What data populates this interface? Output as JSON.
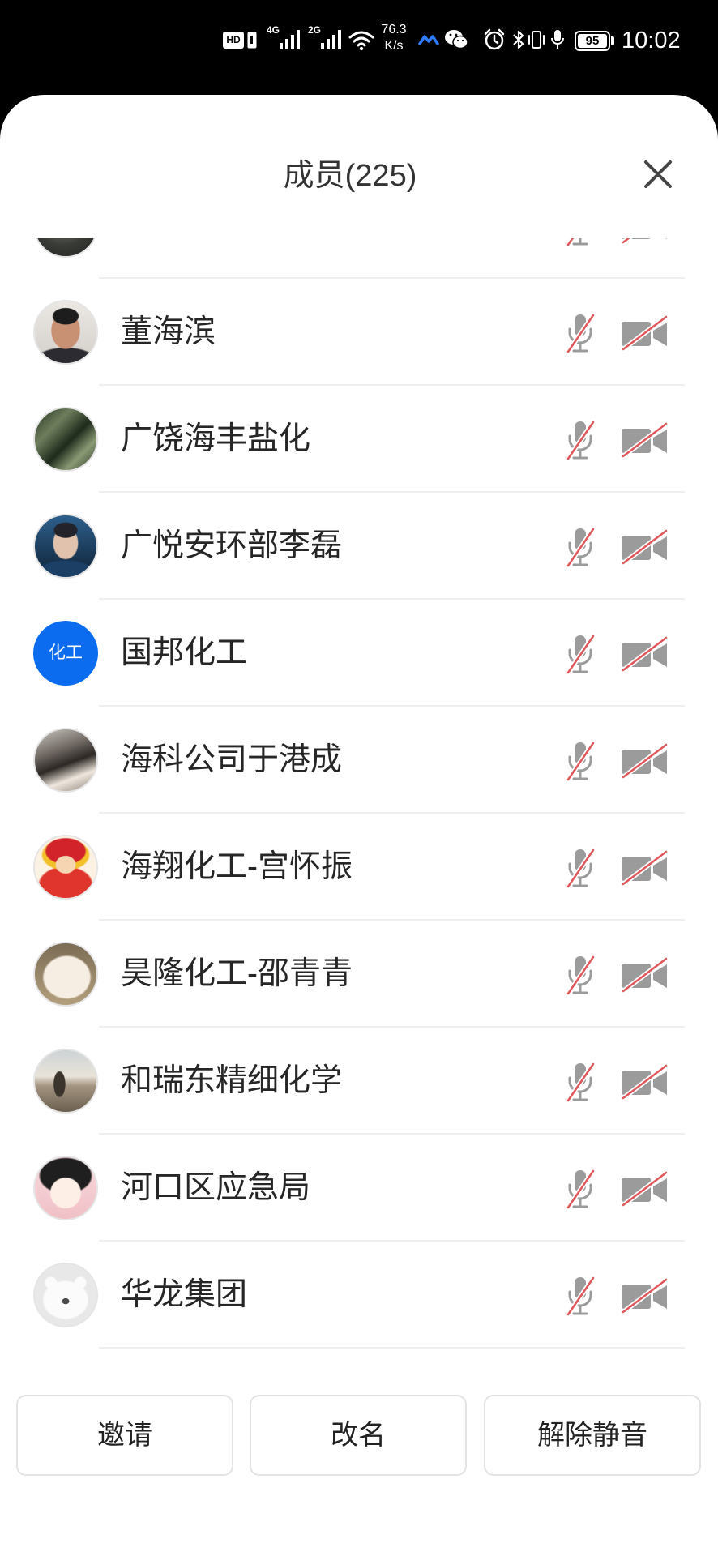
{
  "status_bar": {
    "hd_badge": "HD",
    "sim1_network": "4G",
    "sim2_network": "2G",
    "net_speed": "76.3",
    "net_speed_unit": "K/s",
    "battery_level": "95",
    "time": "10:02",
    "icons": [
      "hd-icon",
      "sim-card-icon",
      "signal-icon",
      "signal-icon",
      "wifi-icon",
      "app-notification-icon",
      "wechat-icon",
      "alarm-icon",
      "bluetooth-icon",
      "vibrate-icon",
      "microphone-icon",
      "battery-icon"
    ]
  },
  "header": {
    "title": "成员(225)",
    "close_icon": "close-icon"
  },
  "members": [
    {
      "name": "",
      "mic_icon": "mic-off-icon",
      "camera_icon": "camera-off-icon"
    },
    {
      "name": "董海滨",
      "mic_icon": "mic-off-icon",
      "camera_icon": "camera-off-icon"
    },
    {
      "name": "广饶海丰盐化",
      "mic_icon": "mic-off-icon",
      "camera_icon": "camera-off-icon"
    },
    {
      "name": "广悦安环部李磊",
      "mic_icon": "mic-off-icon",
      "camera_icon": "camera-off-icon"
    },
    {
      "name": "国邦化工",
      "avatar_text": "化工",
      "mic_icon": "mic-off-icon",
      "camera_icon": "camera-off-icon"
    },
    {
      "name": "海科公司于港成",
      "mic_icon": "mic-off-icon",
      "camera_icon": "camera-off-icon"
    },
    {
      "name": "海翔化工-宫怀振",
      "mic_icon": "mic-off-icon",
      "camera_icon": "camera-off-icon"
    },
    {
      "name": "昊隆化工-邵青青",
      "mic_icon": "mic-off-icon",
      "camera_icon": "camera-off-icon"
    },
    {
      "name": "和瑞东精细化学",
      "mic_icon": "mic-off-icon",
      "camera_icon": "camera-off-icon"
    },
    {
      "name": "河口区应急局",
      "mic_icon": "mic-off-icon",
      "camera_icon": "camera-off-icon"
    },
    {
      "name": "华龙集团",
      "mic_icon": "mic-off-icon",
      "camera_icon": "camera-off-icon"
    }
  ],
  "actions": {
    "invite": "邀请",
    "rename": "改名",
    "unmute": "解除静音"
  },
  "colors": {
    "avatar_blue": "#0B6CF0",
    "muted_slash": "#E0575B",
    "icon_gray": "#9B9B9B",
    "status_app_blue": "#2F7BFF"
  }
}
